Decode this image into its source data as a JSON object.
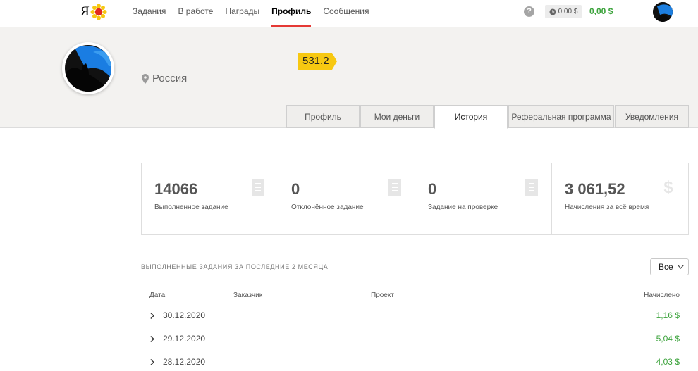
{
  "header": {
    "logo_text": "Я",
    "nav": [
      {
        "label": "Задания",
        "active": false
      },
      {
        "label": "В работе",
        "active": false
      },
      {
        "label": "Награды",
        "active": false
      },
      {
        "label": "Профиль",
        "active": true
      },
      {
        "label": "Сообщения",
        "active": false
      }
    ],
    "help_label": "?",
    "pending_amount": "0,00 $",
    "balance": "0,00 $",
    "icons": [
      "yandex-flower-icon",
      "help-icon",
      "clock-icon",
      "avatar"
    ]
  },
  "profile": {
    "location": "Россия",
    "rating": "531.2",
    "tabs": [
      {
        "label": "Профиль",
        "active": false
      },
      {
        "label": "Мои деньги",
        "active": false
      },
      {
        "label": "История",
        "active": true
      },
      {
        "label": "Реферальная программа",
        "active": false
      },
      {
        "label": "Уведомления",
        "active": false
      }
    ]
  },
  "stats": [
    {
      "value": "14066",
      "label": "Выполненное задание",
      "icon": "list-icon"
    },
    {
      "value": "0",
      "label": "Отклонённое задание",
      "icon": "list-icon"
    },
    {
      "value": "0",
      "label": "Задание на проверке",
      "icon": "list-icon"
    },
    {
      "value": "3 061,52",
      "label": "Начисления за всё время",
      "icon": "dollar-icon"
    }
  ],
  "history": {
    "title": "ВЫПОЛНЕННЫЕ ЗАДАНИЯ ЗА ПОСЛЕДНИЕ 2 МЕСЯЦА",
    "filter": "Все",
    "columns": [
      "Дата",
      "Заказчик",
      "Проект",
      "Начислено"
    ],
    "rows": [
      {
        "date": "30.12.2020",
        "amount": "1,16 $"
      },
      {
        "date": "29.12.2020",
        "amount": "5,04 $"
      },
      {
        "date": "28.12.2020",
        "amount": "4,03 $"
      }
    ]
  },
  "colors": {
    "accent_red": "#e53935",
    "money_green": "#3ca33c",
    "rating_yellow": "#f7c811",
    "band_bg": "#f3f2f0"
  }
}
